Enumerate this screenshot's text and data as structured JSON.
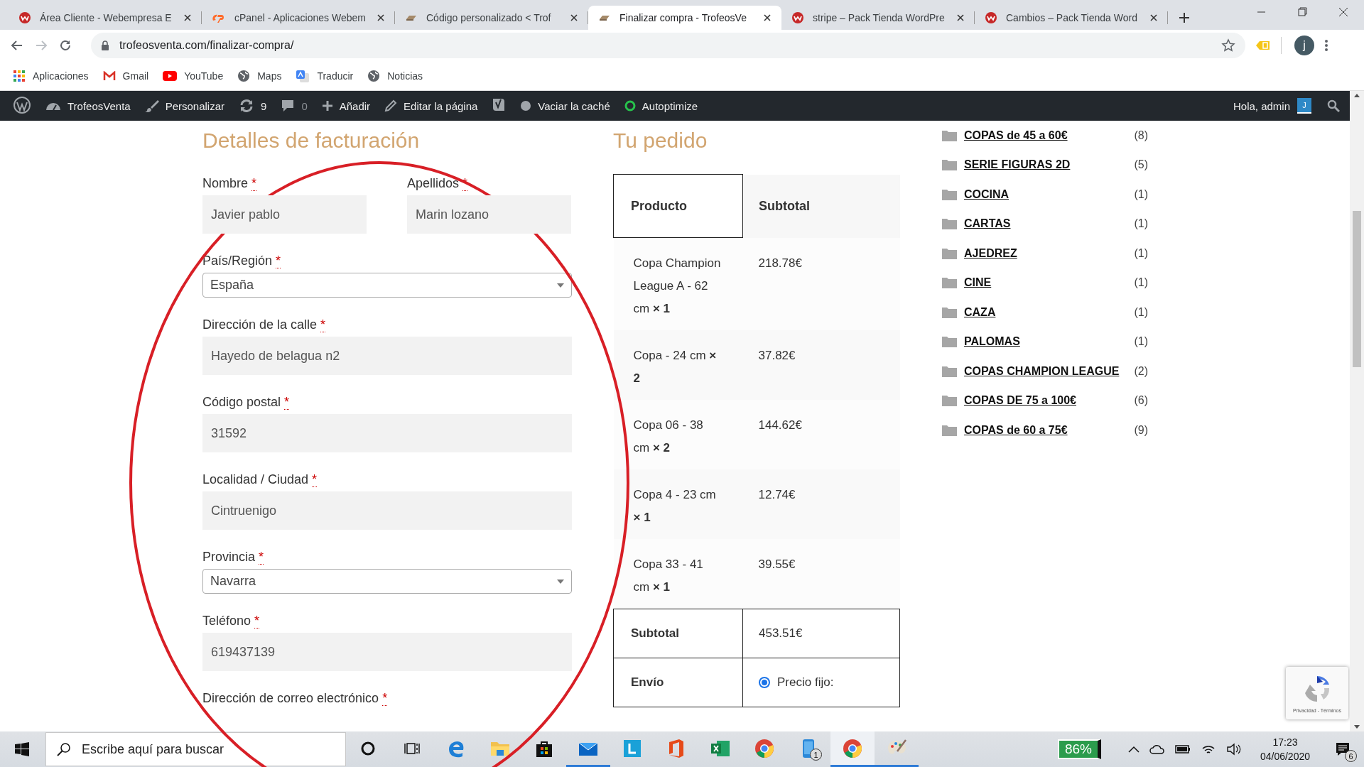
{
  "browser": {
    "tabs": [
      {
        "title": "Área Cliente - Webempresa E",
        "kind": "webempresa",
        "selected": false
      },
      {
        "title": "cPanel - Aplicaciones Webem",
        "kind": "cpanel",
        "selected": false
      },
      {
        "title": "Código personalizado < Trof",
        "kind": "site",
        "selected": false
      },
      {
        "title": "Finalizar compra - TrofeosVe",
        "kind": "site",
        "selected": true
      },
      {
        "title": "stripe – Pack Tienda WordPre",
        "kind": "webempresa",
        "selected": false
      },
      {
        "title": "Cambios – Pack Tienda Word",
        "kind": "webempresa",
        "selected": false
      }
    ],
    "address": "trofeosventa.com/finalizar-compra/",
    "profile_initial": "j",
    "bookmarks": [
      {
        "label": "Aplicaciones",
        "kind": "apps"
      },
      {
        "label": "Gmail",
        "kind": "mail"
      },
      {
        "label": "YouTube",
        "kind": "video"
      },
      {
        "label": "Maps",
        "kind": "globe"
      },
      {
        "label": "Traducir",
        "kind": "translate"
      },
      {
        "label": "Noticias",
        "kind": "globe"
      }
    ]
  },
  "admin_bar": {
    "items": [
      {
        "kind": "wp"
      },
      {
        "kind": "site",
        "label": "TrofeosVenta"
      },
      {
        "kind": "customize",
        "label": "Personalizar"
      },
      {
        "kind": "updates",
        "label": "9"
      },
      {
        "kind": "comments",
        "label": "0"
      },
      {
        "kind": "new",
        "label": "Añadir"
      },
      {
        "kind": "edit",
        "label": "Editar la página"
      },
      {
        "kind": "yoast"
      },
      {
        "kind": "cache",
        "label": "Vaciar la caché"
      },
      {
        "kind": "autoptimize",
        "label": "Autoptimize"
      }
    ],
    "greeting": "Hola, admin",
    "avatar": "J"
  },
  "billing": {
    "title": "Detalles de facturación",
    "fields": [
      {
        "kind": "half",
        "label": "Nombre",
        "marker": "*",
        "value": "Javier pablo"
      },
      {
        "kind": "half",
        "label": "Apellidos",
        "marker": "*",
        "value": "Marin lozano"
      },
      {
        "kind": "select",
        "label": "País/Región",
        "marker": "*",
        "value": "España"
      },
      {
        "kind": "text",
        "label": "Dirección de la calle",
        "marker": "*",
        "value": "Hayedo de belagua n2"
      },
      {
        "kind": "text",
        "label": "Código postal",
        "marker": "*",
        "value": "31592"
      },
      {
        "kind": "text",
        "label": "Localidad / Ciudad",
        "marker": "*",
        "value": "Cintruenigo"
      },
      {
        "kind": "select",
        "label": "Provincia",
        "marker": "*",
        "value": "Navarra"
      },
      {
        "kind": "text",
        "label": "Teléfono",
        "marker": "*",
        "value": "619437139"
      },
      {
        "kind": "label",
        "label": "Dirección de correo electrónico",
        "marker": "*"
      }
    ]
  },
  "order": {
    "title": "Tu pedido",
    "columns": [
      "Producto",
      "Subtotal"
    ],
    "items": [
      {
        "product": "Copa Champion League A - 62 cm **× 1**",
        "subtotal": "218.78€"
      },
      {
        "product": "Copa - 24 cm **× 2**",
        "subtotal": "37.82€"
      },
      {
        "product": "Copa 06 - 38 cm **× 2**",
        "subtotal": "144.62€"
      },
      {
        "product": "Copa 4 - 23 cm **× 1**",
        "subtotal": "12.74€"
      },
      {
        "product": "Copa 33 - 41 cm **× 1**",
        "subtotal": "39.55€"
      }
    ],
    "subtotal": {
      "label": "Subtotal",
      "value": "453.51€"
    },
    "shipping": {
      "label": "Envío",
      "options": [
        {
          "label": "Precio fijo:",
          "selected": true
        }
      ]
    }
  },
  "categories": [
    {
      "name": "COPAS de 45 a 60€",
      "count": "(8)"
    },
    {
      "name": "SERIE FIGURAS 2D",
      "count": "(5)"
    },
    {
      "name": "COCINA",
      "count": "(1)"
    },
    {
      "name": "CARTAS",
      "count": "(1)"
    },
    {
      "name": "AJEDREZ",
      "count": "(1)"
    },
    {
      "name": "CINE",
      "count": "(1)"
    },
    {
      "name": "CAZA",
      "count": "(1)"
    },
    {
      "name": "PALOMAS",
      "count": "(1)"
    },
    {
      "name": "COPAS CHAMPION LEAGUE",
      "count": "(2)"
    },
    {
      "name": "COPAS DE 75 a 100€",
      "count": "(6)"
    },
    {
      "name": "COPAS de 60 a 75€",
      "count": "(9)"
    }
  ],
  "recaptcha": {
    "links": "Privacidad - Términos"
  },
  "taskbar": {
    "search": {
      "placeholder": "Escribe aquí para buscar"
    },
    "apps": [
      {
        "kind": "cortana",
        "running": false,
        "selected": false
      },
      {
        "kind": "taskview",
        "running": false,
        "selected": false
      },
      {
        "kind": "edge",
        "running": false,
        "selected": false
      },
      {
        "kind": "explorer",
        "running": false,
        "selected": false
      },
      {
        "kind": "store",
        "running": false,
        "selected": false
      },
      {
        "kind": "mail",
        "running": true,
        "selected": false
      },
      {
        "kind": "lapp",
        "running": false,
        "selected": false
      },
      {
        "kind": "office",
        "running": false,
        "selected": false
      },
      {
        "kind": "excel",
        "running": false,
        "selected": false
      },
      {
        "kind": "chrome",
        "running": false,
        "selected": false
      },
      {
        "kind": "phone",
        "running": false,
        "selected": false,
        "badge": "1"
      },
      {
        "kind": "chrome",
        "running": true,
        "selected": true
      },
      {
        "kind": "paint",
        "running": true,
        "selected": false
      }
    ],
    "battery": "86%",
    "time": "17:23",
    "date": "04/06/2020",
    "notifications": "6"
  },
  "annotation": {
    "kind": "ellipse"
  }
}
